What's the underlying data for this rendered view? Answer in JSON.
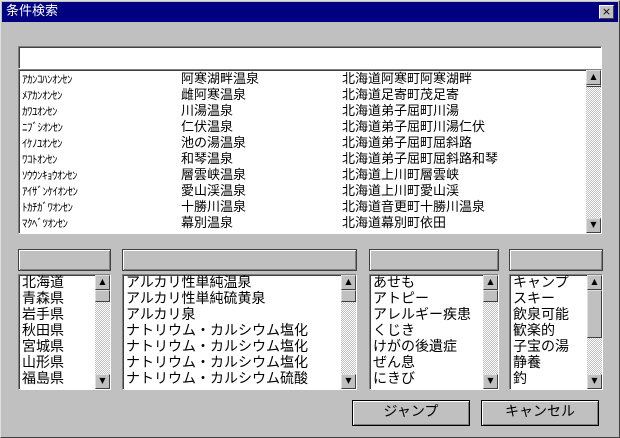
{
  "window": {
    "title": "条件検索",
    "close_glyph": "×"
  },
  "search": {
    "value": ""
  },
  "results": {
    "rows": [
      [
        "ｱｶﾝｺﾊﾝｵﾝｾﾝ",
        "阿寒湖畔温泉",
        "北海道阿寒町阿寒湖畔"
      ],
      [
        "ﾒｱｶﾝｵﾝｾﾝ",
        "雌阿寒温泉",
        "北海道足寄町茂足寄"
      ],
      [
        "ｶﾜﾕｵﾝｾﾝ",
        "川湯温泉",
        "北海道弟子屈町川湯"
      ],
      [
        "ﾆﾌﾞｼｵﾝｾﾝ",
        "仁伏温泉",
        "北海道弟子屈町川湯仁伏"
      ],
      [
        "ｲｹﾉﾕｵﾝｾﾝ",
        "池の湯温泉",
        "北海道弟子屈町屈斜路"
      ],
      [
        "ﾜｺﾄｵﾝｾﾝ",
        "和琴温泉",
        "北海道弟子屈町屈斜路和琴"
      ],
      [
        "ｿｳｳﾝｷｮｳｵﾝｾﾝ",
        "層雲峡温泉",
        "北海道上川町層雲峡"
      ],
      [
        "ｱｲｻﾞﾝｹｲｵﾝｾﾝ",
        "愛山渓温泉",
        "北海道上川町愛山渓"
      ],
      [
        "ﾄｶﾁｶﾞﾜｵﾝｾﾝ",
        "十勝川温泉",
        "北海道音更町十勝川温泉"
      ],
      [
        "ﾏｸﾍﾞﾂｵﾝｾﾝ",
        "幕別温泉",
        "北海道幕別町依田"
      ]
    ]
  },
  "filters": {
    "prefecture": {
      "header": "",
      "items": [
        "北海道",
        "青森県",
        "岩手県",
        "秋田県",
        "宮城県",
        "山形県",
        "福島県"
      ]
    },
    "spring_type": {
      "header": "",
      "items": [
        "アルカリ性単純温泉",
        "アルカリ性単純硫黄泉",
        "アルカリ泉",
        "ナトリウム・カルシウム塩化",
        "ナトリウム・カルシウム塩化",
        "ナトリウム・カルシウム塩化",
        "ナトリウム・カルシウム硫酸"
      ]
    },
    "efficacy": {
      "header": "",
      "items": [
        "あせも",
        "アトピー",
        "アレルギー疾患",
        "くじき",
        "けがの後遺症",
        "ぜん息",
        "にきび"
      ]
    },
    "facility": {
      "header": "",
      "items": [
        "キャンプ",
        "スキー",
        "飲泉可能",
        "歓楽的",
        "子宝の湯",
        "静養",
        "釣"
      ]
    }
  },
  "buttons": {
    "jump": "ジャンプ",
    "cancel": "キャンセル"
  },
  "icons": {
    "scroll_up": "▲",
    "scroll_down": "▼"
  }
}
